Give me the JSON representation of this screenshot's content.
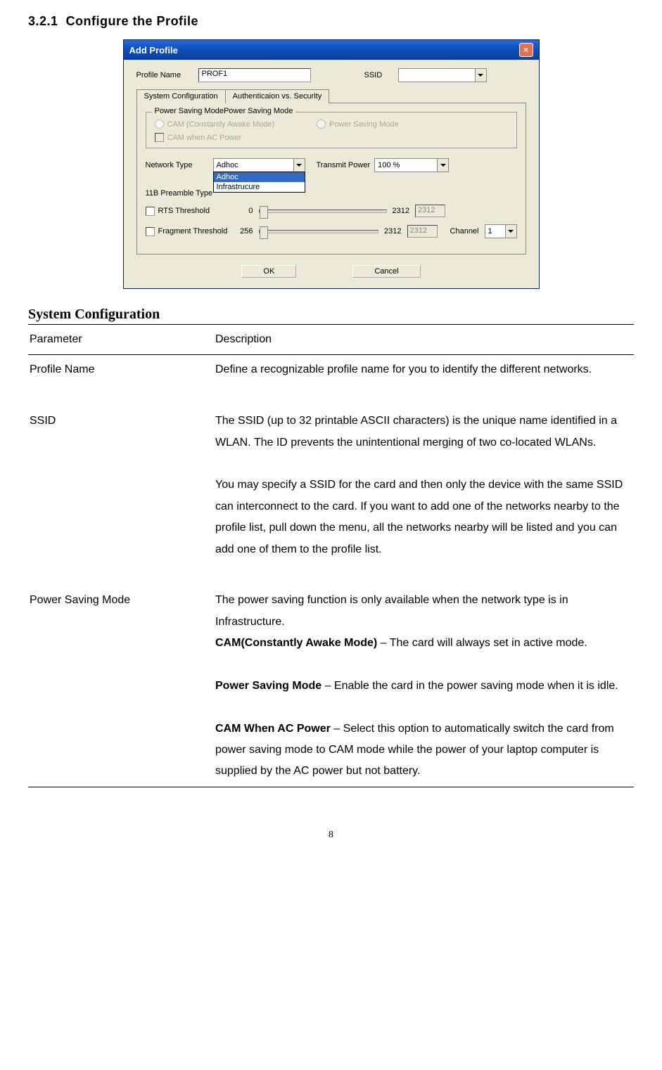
{
  "section_number": "3.2.1",
  "section_title": "Configure the Profile",
  "dialog": {
    "title": "Add Profile",
    "profile_name_label": "Profile Name",
    "profile_name_value": "PROF1",
    "ssid_label": "SSID",
    "tabs": {
      "system_config": "System Configuration",
      "auth_security": "Authenticaion vs. Security"
    },
    "groupbox_title": "Power Saving ModePower Saving Mode",
    "cam_label": "CAM (Constantly Awake Mode)",
    "psm_label": "Power Saving Mode",
    "cam_ac_label": "CAM when AC Power",
    "network_type_label": "Network Type",
    "network_type_value": "Adhoc",
    "network_type_options": {
      "adhoc": "Adhoc",
      "infra": "Infrastrucure"
    },
    "transmit_power_label": "Transmit Power",
    "transmit_power_value": "100 %",
    "preamble_label": "11B Preamble Type",
    "rts_label": "RTS Threshold",
    "rts_min": "0",
    "rts_max": "2312",
    "rts_value": "2312",
    "frag_label": "Fragment Threshold",
    "frag_min": "256",
    "frag_max": "2312",
    "frag_value": "2312",
    "channel_label": "Channel",
    "channel_value": "1",
    "ok_button": "OK",
    "cancel_button": "Cancel"
  },
  "config_heading": "System Configuration",
  "table": {
    "header": {
      "param": "Parameter",
      "desc": "Description"
    },
    "rows": [
      {
        "param": "Profile Name",
        "desc": "Define a recognizable profile name for you to identify the different networks."
      },
      {
        "param": "SSID",
        "desc_p1": "The SSID (up to 32 printable ASCII characters) is the unique name identified in a WLAN. The ID prevents the unintentional merging of two co-located WLANs.",
        "desc_p2": "You may specify a SSID for the card and then only the device with the same SSID can interconnect to the card. If you want to add one of the networks nearby to the profile list, pull down the menu, all the networks nearby will be listed and you can add one of them to the profile list."
      },
      {
        "param": "Power Saving Mode",
        "desc_p1": "The power saving function is only available when the network type is in Infrastructure.",
        "cam_bold": "CAM(Constantly Awake Mode)",
        "cam_rest": " – The card will always set in active mode.",
        "psm_bold": "Power Saving Mode",
        "psm_rest": " – Enable the card in the power saving mode when it is idle.",
        "ac_bold": "CAM When AC Power",
        "ac_rest": " – Select this option to automatically switch the card from power saving mode to CAM mode while the power of your laptop computer is supplied by the AC power but not battery."
      }
    ]
  },
  "page_number": "8"
}
